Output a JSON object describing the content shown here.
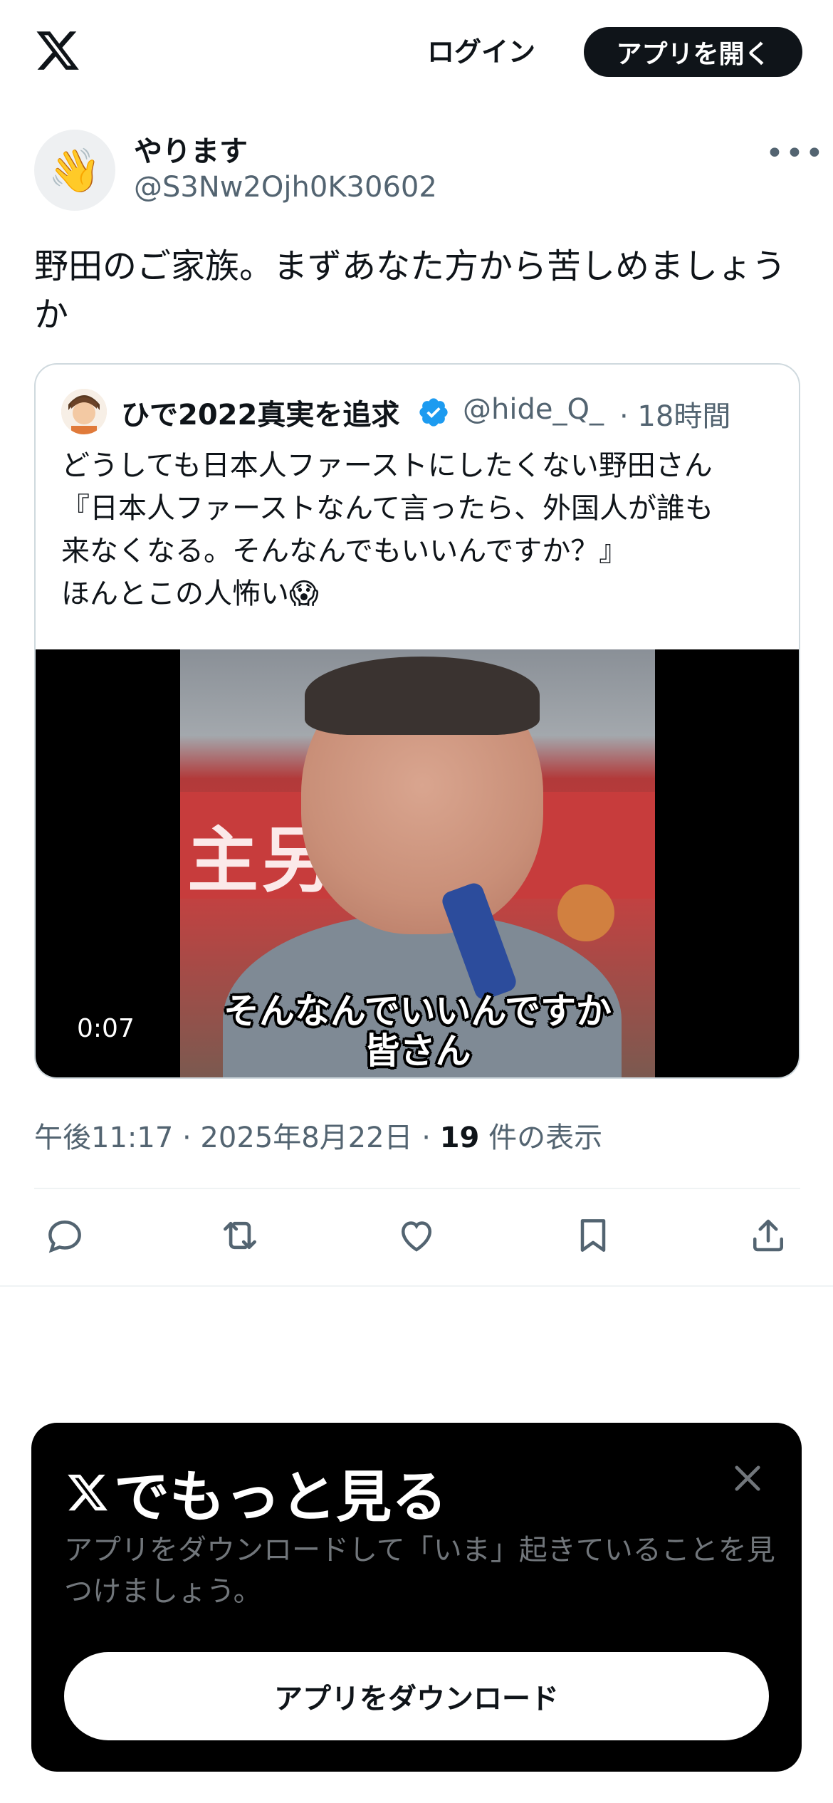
{
  "header": {
    "logo_icon": "x-logo-icon",
    "login_label": "ログイン",
    "open_app_label": "アプリを開く"
  },
  "post": {
    "author_name": "やります",
    "author_handle": "@S3Nw2Ojh0K30602",
    "avatar_emoji": "👋",
    "text": "野田のご家族。まずあなた方から苦しめましょうか",
    "quote": {
      "name": "ひで2022真実を追求",
      "handle": "@hide_Q_",
      "time": "· 18時間",
      "lines": [
        "どうしても日本人ファーストにしたくない野田さん",
        "『日本人ファーストなんて言ったら、外国人が誰も",
        "来なくなる。そんなんでもいいんですか？』",
        "ほんとこの人怖い😱"
      ],
      "video": {
        "duration": "0:07",
        "banner_text": "主另党",
        "subtitle_line1": "そんなんでいいんですか",
        "subtitle_line2": "皆さん"
      }
    },
    "meta": {
      "time_date": "午後11:17 · 2025年8月22日 · ",
      "views_count": "19",
      "views_label": " 件の表示"
    },
    "actions": [
      "reply-icon",
      "repost-icon",
      "like-icon",
      "bookmark-icon",
      "share-icon"
    ]
  },
  "sheet": {
    "title": "でもっと見る",
    "description": "アプリをダウンロードして「いま」起きていることを見つけましょう。",
    "download_label": "アプリをダウンロード"
  },
  "colors": {
    "primary_text": "#0f1419",
    "secondary_text": "#536471",
    "verified_blue": "#1d9bf0",
    "sheet_bg": "#000000"
  }
}
